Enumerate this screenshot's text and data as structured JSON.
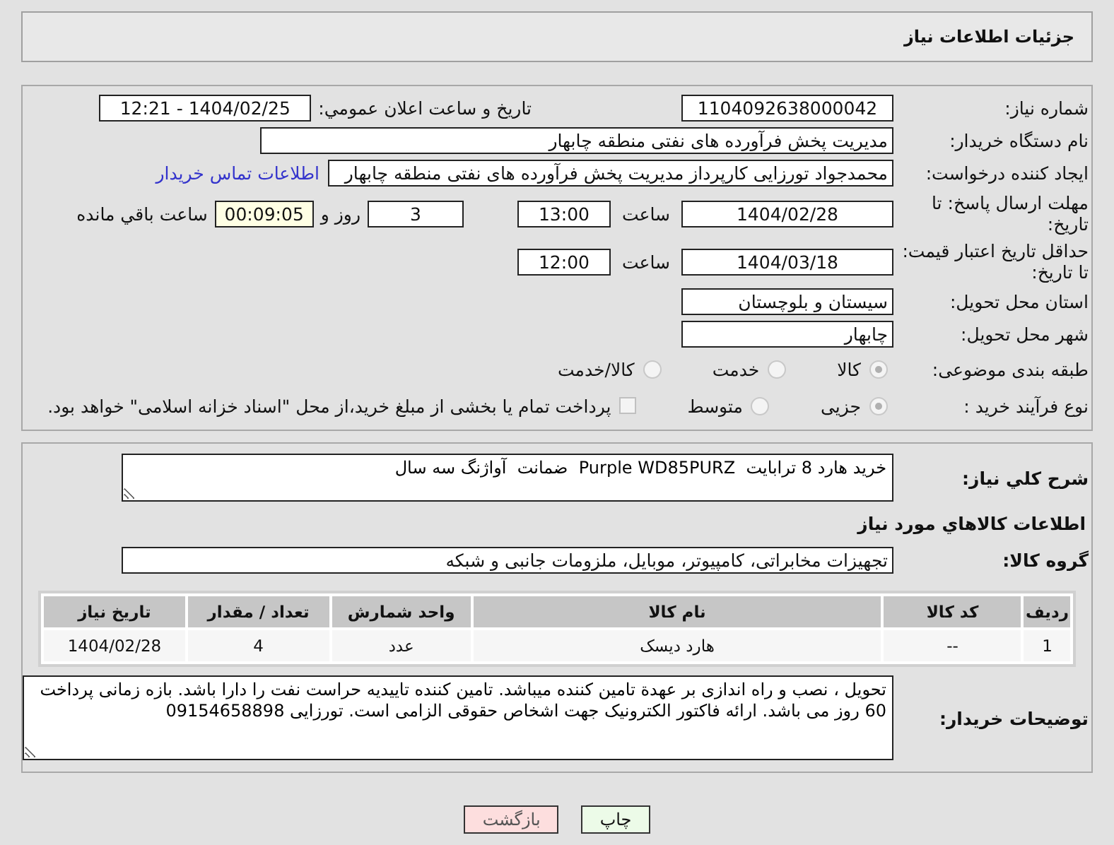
{
  "header": {
    "title": "جزئیات اطلاعات نیاز"
  },
  "form": {
    "need_number": {
      "label": "شماره نیاز:",
      "value": "1104092638000042"
    },
    "announce": {
      "label": "تاریخ و ساعت اعلان عمومي:",
      "value": "1404/02/25 - 12:21"
    },
    "buyer_org": {
      "label": "نام دستگاه خریدار:",
      "value": "مدیریت پخش فرآورده های نفتی منطقه چابهار"
    },
    "requester": {
      "label": "ایجاد کننده درخواست:",
      "value": "محمدجواد تورزایی کارپرداز مدیریت پخش فرآورده های نفتی منطقه چابهار",
      "link": "اطلاعات تماس خریدار"
    },
    "reply_deadline": {
      "label": "مهلت ارسال پاسخ: تا تاریخ:",
      "date": "1404/02/28",
      "time_label": "ساعت",
      "time": "13:00",
      "days": "3",
      "days_label": "روز و",
      "remaining": "00:09:05",
      "remaining_label": "ساعت باقي مانده"
    },
    "price_validity": {
      "label": "حداقل تاریخ اعتبار قیمت: تا تاریخ:",
      "date": "1404/03/18",
      "time_label": "ساعت",
      "time": "12:00"
    },
    "province": {
      "label": "استان محل تحویل:",
      "value": "سیستان و بلوچستان"
    },
    "city": {
      "label": "شهر محل تحویل:",
      "value": "چابهار"
    },
    "category": {
      "label": "طبقه بندی موضوعی:",
      "options": [
        {
          "label": "کالا",
          "selected": true
        },
        {
          "label": "خدمت",
          "selected": false
        },
        {
          "label": "کالا/خدمت",
          "selected": false
        }
      ]
    },
    "process": {
      "label": "نوع فرآیند خرید :",
      "options": [
        {
          "label": "جزیی",
          "selected": true
        },
        {
          "label": "متوسط",
          "selected": false
        }
      ],
      "treasury": {
        "checked": false,
        "text": "پرداخت تمام یا بخشی از مبلغ خرید،از محل \"اسناد خزانه اسلامی\" خواهد بود."
      }
    }
  },
  "summary": {
    "label": "شرح كلي نياز:",
    "value": "خرید هارد 8 ترابایت  Purple WD85PURZ  ضمانت  آواژنگ سه سال"
  },
  "goods": {
    "heading": "اطلاعات كالاهاي مورد نياز",
    "group_label": "گروه کالا:",
    "group": "تجهیزات مخابراتی، کامپیوتر، موبایل، ملزومات جانبی و شبکه",
    "columns": [
      "ردیف",
      "کد کالا",
      "نام کالا",
      "واحد شمارش",
      "تعداد / مقدار",
      "تاریخ نیاز"
    ],
    "rows": [
      [
        "1",
        "--",
        "هارد دیسک",
        "عدد",
        "4",
        "1404/02/28"
      ]
    ]
  },
  "notes": {
    "label": "توضیحات خریدار:",
    "value": "تحویل ، نصب و راه اندازی بر عهدة تامین کننده میباشد. تامین کننده تاییدیه حراست نفت را دارا باشد. بازه زمانی پرداخت 60 روز می باشد. ارائه فاکتور الکترونیک جهت اشخاص حقوقی الزامی است. تورزایی 09154658898"
  },
  "buttons": [
    {
      "label": "چاپ",
      "kind": "print"
    },
    {
      "label": "بازگشت",
      "kind": "back"
    }
  ]
}
